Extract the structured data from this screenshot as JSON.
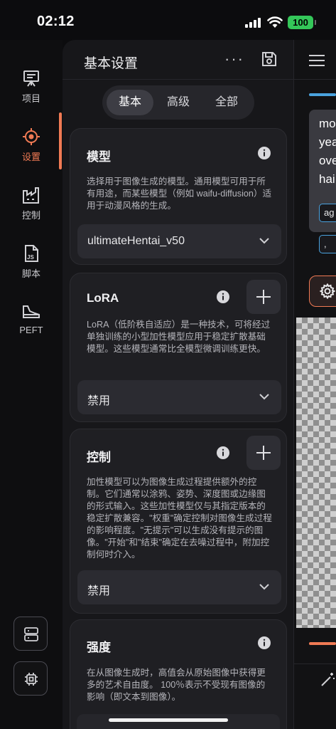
{
  "status": {
    "time": "02:12",
    "battery": "100"
  },
  "nav": {
    "items": [
      {
        "label": "项目",
        "icon": "easel-icon"
      },
      {
        "label": "设置",
        "icon": "settings-target-icon"
      },
      {
        "label": "控制",
        "icon": "factory-icon"
      },
      {
        "label": "脚本",
        "icon": "js-file-icon"
      },
      {
        "label": "PEFT",
        "icon": "sneaker-icon"
      }
    ],
    "active": "设置",
    "accent": "#f07a54"
  },
  "panel": {
    "title": "基本设置",
    "more": "···",
    "tabs": [
      "基本",
      "高级",
      "全部"
    ],
    "selected_tab": "基本"
  },
  "sections": {
    "model": {
      "title": "模型",
      "description": "选择用于图像生成的模型。通用模型可用于所有用途，而某些模型（例如 waifu-diffusion）适用于动漫风格的生成。",
      "value": "ultimateHentai_v50"
    },
    "lora": {
      "title": "LoRA",
      "description": "LoRA（低阶秩自适应）是一种技术，可将经过单独训练的小型加性模型应用于稳定扩散基础模型。这些模型通常比全模型微调训练更快。",
      "value": "禁用"
    },
    "control": {
      "title": "控制",
      "description": "加性模型可以为图像生成过程提供额外的控制。它们通常以涂鸦、姿势、深度图或边缘图的形式输入。这些加性模型仅与其指定版本的稳定扩散兼容。\"权重\"确定控制对图像生成过程的影响程度。\"无提示\"可以生成没有提示的图像。\"开始\"和\"结束\"确定在去噪过程中，附加控制何时介入。",
      "value": "禁用"
    },
    "strength": {
      "title": "强度",
      "description": "在从图像生成时，高值会从原始图像中获得更多的艺术自由度。 100％表示不受现有图像的影响（即文本到图像）。"
    }
  },
  "right": {
    "prompt_lines": [
      "mo",
      "yea",
      "ove",
      "hai"
    ],
    "tags": [
      "ag",
      ", "
    ]
  }
}
